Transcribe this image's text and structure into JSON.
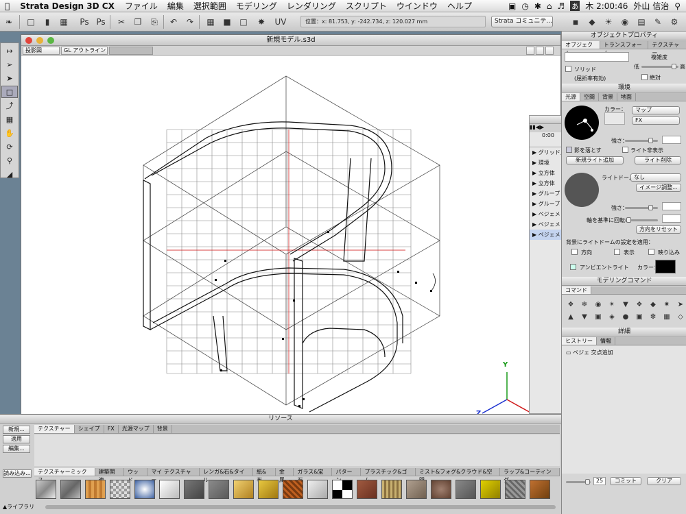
{
  "menubar": {
    "app": "Strata Design 3D CX",
    "items": [
      "ファイル",
      "編集",
      "選択範囲",
      "モデリング",
      "レンダリング",
      "スクリプト",
      "ウインドウ",
      "ヘルプ"
    ],
    "ime": "あ",
    "clock": "木 2:00:46",
    "user": "外山 信治"
  },
  "toolbar": {
    "coords": "位置：x: 81.753, y: -242.734, z: 120.027 mm",
    "view_select": "Strata コミュニテ..."
  },
  "document": {
    "title": "新規モデル.s3d",
    "projection": "投影図",
    "render_mode": "GL アウトライン"
  },
  "outliner": {
    "time": "0:00",
    "items": [
      "グリッド／ガ",
      "環境",
      "立方体",
      "立方体",
      "グループ",
      "グループ",
      "ベジェメッ",
      "ベジェメッ",
      "ベジェメッ"
    ]
  },
  "object_props": {
    "title": "オブジェクトプロパティ",
    "tabs": [
      "オブジェクト",
      "トランスフォーム",
      "テクスチャー"
    ],
    "complexity": "複雑度",
    "low": "低",
    "high": "高",
    "solid": "ソリッド",
    "refraction": "(屈折率有効)",
    "absolute": "絶対"
  },
  "environment": {
    "title": "環境",
    "tabs": [
      "光源",
      "空間",
      "背景",
      "地面"
    ],
    "color": "カラー：",
    "map": "マップ",
    "fx": "FX",
    "strength": "強さ：",
    "cast_shadow": "影を落とす",
    "light_hidden": "ライト非表示",
    "add_light": "新規ライト追加",
    "delete_light": "ライト削除",
    "light_dome": "ライトドーム：",
    "dome_value": "なし",
    "image_adjust": "イメージ調整...",
    "strength2": "強さ：",
    "axis_rotate": "軸を基準に回転：",
    "reset_dir": "方向をリセット",
    "apply_bg": "背景にライトドームの設定を適用：",
    "dir": "方向",
    "show": "表示",
    "reflect": "映り込み",
    "ambient": "アンビエントライト",
    "ambient_color": "カラー："
  },
  "modeling": {
    "title": "モデリングコマンド",
    "tab": "コマンド"
  },
  "details": {
    "title": "詳細",
    "tabs": [
      "ヒストリー",
      "情報"
    ],
    "history_item": "ベジェ 交点追加",
    "value": "25",
    "commit": "コミット",
    "clear": "クリア"
  },
  "resources": {
    "title": "リソース",
    "buttons": [
      "新規...",
      "適用",
      "編集...",
      "読み込み..."
    ],
    "tabs": [
      "テクスチャー",
      "シェイプ",
      "FX",
      "光源マップ",
      "背景"
    ],
    "categories": [
      "テクスチャーミックス",
      "建築関連",
      "ウッド",
      "マイ テクスチャー",
      "レンガ&石&タイル",
      "紙&布",
      "金属",
      "ガラス&宝石",
      "パターン",
      "プラスチック&ゴム",
      "ミスト&フォグ&クラウド&空間",
      "ラップ&コーティング"
    ],
    "library": "ライブラリ"
  },
  "axis": {
    "y": "Y",
    "z": "Z"
  }
}
